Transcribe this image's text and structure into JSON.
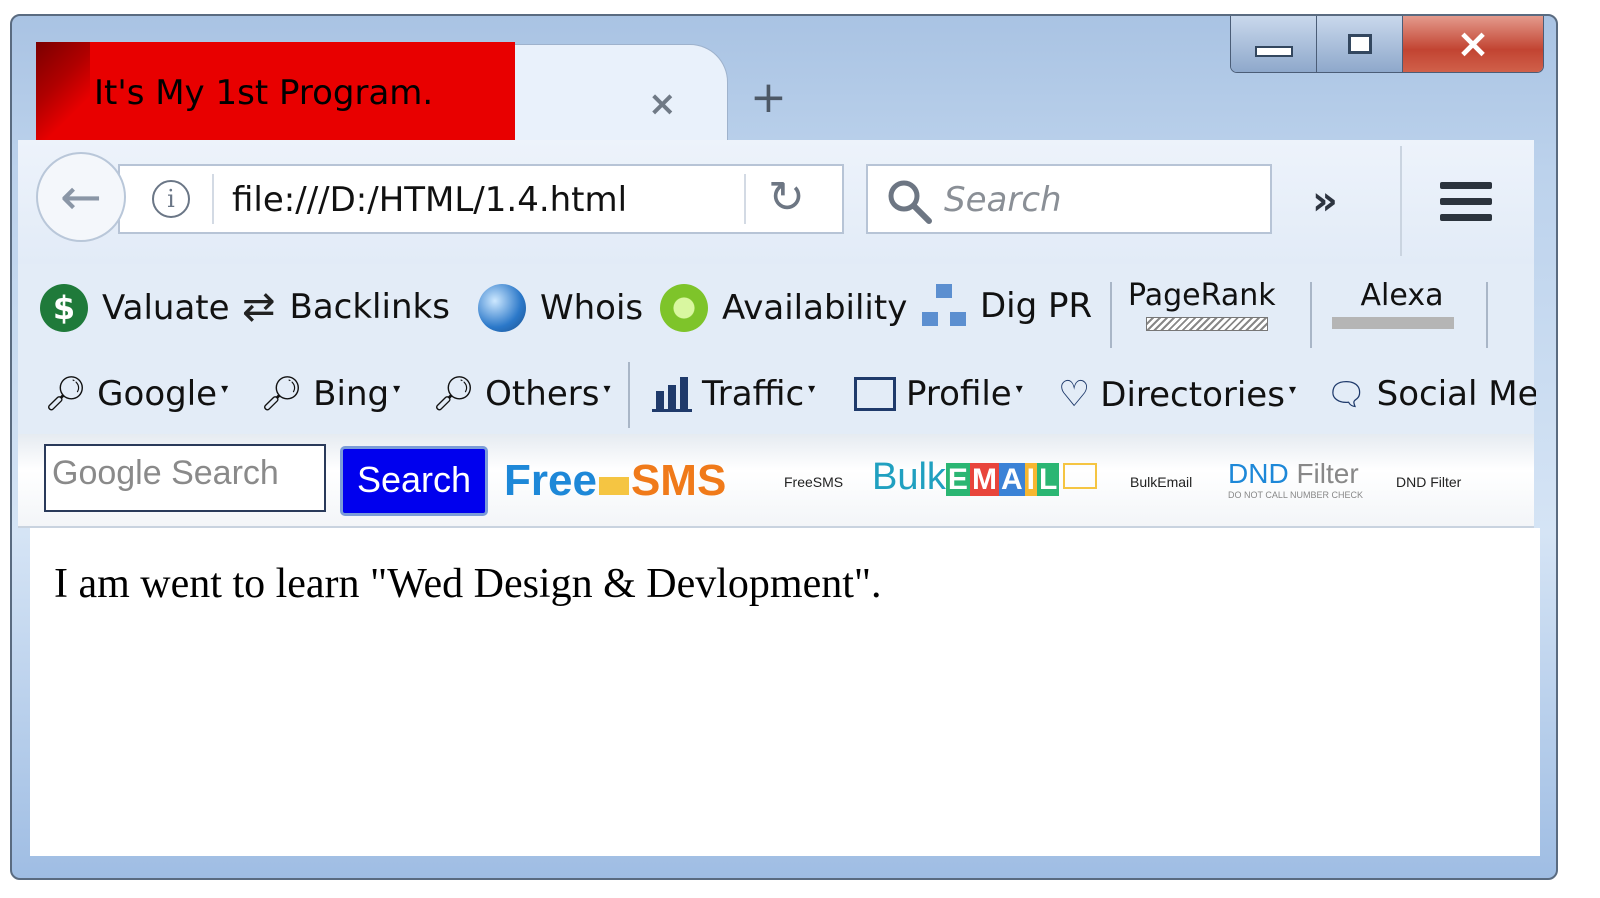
{
  "window": {
    "tab_title": "It's My 1st Program.",
    "tab_close": "×",
    "new_tab": "+",
    "controls": {
      "minimize": "minimize",
      "maximize": "maximize",
      "close": "×"
    }
  },
  "nav": {
    "back": "←",
    "info": "i",
    "url": "file:///D:/HTML/1.4.html",
    "reload": "↻",
    "search_placeholder": "Search",
    "overflow": "»"
  },
  "bookmarks_row1": [
    {
      "label": "Valuate",
      "icon": "dollar-icon"
    },
    {
      "label": "Backlinks",
      "icon": "arrows-icon"
    },
    {
      "label": "Whois",
      "icon": "globe-icon"
    },
    {
      "label": "Availability",
      "icon": "magnifier-green-icon"
    },
    {
      "label": "Dig PR",
      "icon": "network-icon"
    }
  ],
  "pagerank": {
    "label": "PageRank"
  },
  "alexa": {
    "label": "Alexa"
  },
  "bookmarks_row2": [
    {
      "label": "Google",
      "icon": "key-icon"
    },
    {
      "label": "Bing",
      "icon": "key-icon"
    },
    {
      "label": "Others",
      "icon": "key-icon"
    },
    {
      "label": "Traffic",
      "icon": "bar-chart-icon"
    },
    {
      "label": "Profile",
      "icon": "id-card-icon"
    },
    {
      "label": "Directories",
      "icon": "heart-icon"
    },
    {
      "label": "Social Me",
      "icon": "speech-bubble-icon"
    }
  ],
  "row3": {
    "google_placeholder": "Google Search",
    "search_button": "Search",
    "free": "Free",
    "sms": "SMS",
    "freesms_small": "FreeSMS",
    "bulk": "Bulk",
    "email_letters": [
      "E",
      "M",
      "A",
      "I",
      "L"
    ],
    "bulkemail_small": "BulkEmail",
    "dnd": "DND",
    "filter": "Filter",
    "dnd_tagline": "DO NOT CALL NUMBER CHECK",
    "dnd_small": "DND Filter"
  },
  "page": {
    "text": "I am went to learn \"Wed Design & Devlopment\"."
  },
  "colors": {
    "tab_red": "#e80000",
    "search_btn": "#0000ee"
  }
}
